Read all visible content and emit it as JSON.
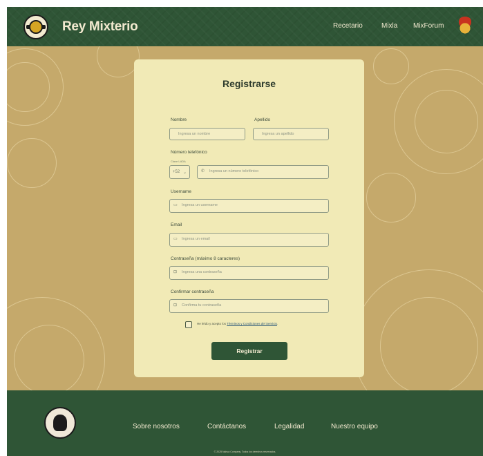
{
  "header": {
    "brand": "Rey Mixterio",
    "nav": [
      "Recetario",
      "Mixla",
      "MixForum"
    ]
  },
  "form": {
    "title": "Registrarse",
    "labels": {
      "nombre": "Nombre",
      "apellido": "Apellido",
      "telefono": "Número telefónico",
      "codigo": "Clave LADA",
      "username": "Username",
      "email": "Email",
      "password": "Contraseña (máximo 8 caracteres)",
      "confirm": "Confirmar contraseña"
    },
    "placeholders": {
      "nombre": "Ingresa un nombre",
      "apellido": "Ingresa un apellido",
      "telefono": "Ingresa un número telefónico",
      "username": "Ingresa un username",
      "email": "Ingresa un email",
      "password": "Ingresa una contraseña",
      "confirm": "Confirma tu contraseña"
    },
    "lada_value": "+52",
    "terms_prefix": "He leído y acepto los ",
    "terms_link": "Términos y Condiciones del Servicio",
    "terms_suffix": ".",
    "submit": "Registrar"
  },
  "footer": {
    "links": [
      "Sobre nosotros",
      "Contáctanos",
      "Legalidad",
      "Nuestro equipo"
    ],
    "copyright": "© 2025 Nahua Company. Todos los derechos reservados."
  },
  "colors": {
    "primary_green": "#2f5536",
    "background_tan": "#c5a96b",
    "card": "#f1eab6",
    "text_light": "#f3ead0"
  },
  "icons": [
    "logo-badge",
    "user-avatar",
    "phone-icon",
    "user-icon",
    "mail-icon",
    "lock-icon",
    "chevron-down-icon",
    "company-logo"
  ]
}
